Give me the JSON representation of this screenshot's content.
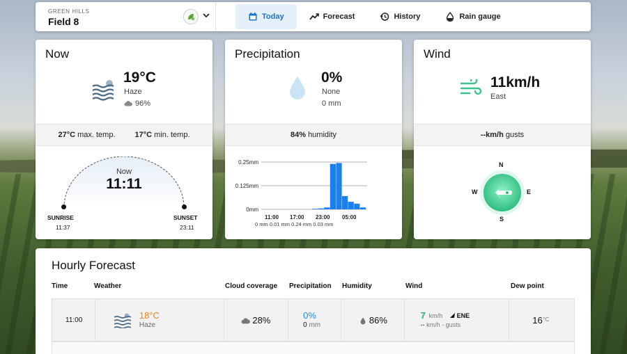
{
  "header": {
    "farm": "GREEN HILLS",
    "field": "Field 8",
    "tabs": [
      {
        "label": "Today",
        "icon": "calendar-icon",
        "active": true
      },
      {
        "label": "Forecast",
        "icon": "trend-icon",
        "active": false
      },
      {
        "label": "History",
        "icon": "history-icon",
        "active": false
      },
      {
        "label": "Rain gauge",
        "icon": "raindrop-icon",
        "active": false
      }
    ]
  },
  "now": {
    "title": "Now",
    "temp": "19°C",
    "condition": "Haze",
    "cloud": "96%",
    "max_temp": "27°C",
    "max_label": "max. temp.",
    "min_temp": "17°C",
    "min_label": "min. temp.",
    "now_label": "Now",
    "time": "11:11",
    "sunrise_label": "SUNRISE",
    "sunrise": "11:37",
    "sunset_label": "SUNSET",
    "sunset": "23:11"
  },
  "precipitation": {
    "title": "Precipitation",
    "chance": "0%",
    "label": "None",
    "amount": "0 mm",
    "humidity": "84%",
    "humidity_label": "humidity"
  },
  "chart_data": {
    "type": "bar",
    "yticks": [
      "0.25mm",
      "0.125mm",
      "0mm"
    ],
    "ylim": [
      0,
      0.25
    ],
    "xticks": [
      "11:00",
      "17:00",
      "23:00",
      "05:00"
    ],
    "totals": "0 mm 0.01 mm 0.24 mm 0.03 mm",
    "values": [
      0,
      0,
      0,
      0,
      0,
      0.003,
      0.005,
      0.01,
      0.24,
      0.245,
      0.07,
      0.04,
      0.03,
      0.01
    ],
    "color": "#1a7ff0"
  },
  "wind": {
    "title": "Wind",
    "speed": "11km/h",
    "direction": "East",
    "gusts": "--km/h",
    "gusts_label": "gusts",
    "compass": {
      "n": "N",
      "e": "E",
      "s": "S",
      "w": "W"
    }
  },
  "hourly": {
    "title": "Hourly Forecast",
    "columns": [
      "Time",
      "Weather",
      "Cloud coverage",
      "Precipitation",
      "Humidity",
      "Wind",
      "Dew point"
    ],
    "rows": [
      {
        "time": "11:00",
        "temp": "18°C",
        "condition": "Haze",
        "cloud": "28%",
        "precip_chance": "0%",
        "precip_amount": "0",
        "precip_unit": "mm",
        "humidity": "86%",
        "wind_speed": "7",
        "wind_unit": "km/h",
        "wind_dir": "ENE",
        "gust": "--",
        "gust_text": "km/h - gusts",
        "dew": "16",
        "dew_unit": "°C"
      }
    ]
  },
  "colors": {
    "accent": "#1a73c9",
    "temp_orange": "#f0841a",
    "precip_blue": "#1a8ae0",
    "wind_green": "#3cc28a"
  }
}
